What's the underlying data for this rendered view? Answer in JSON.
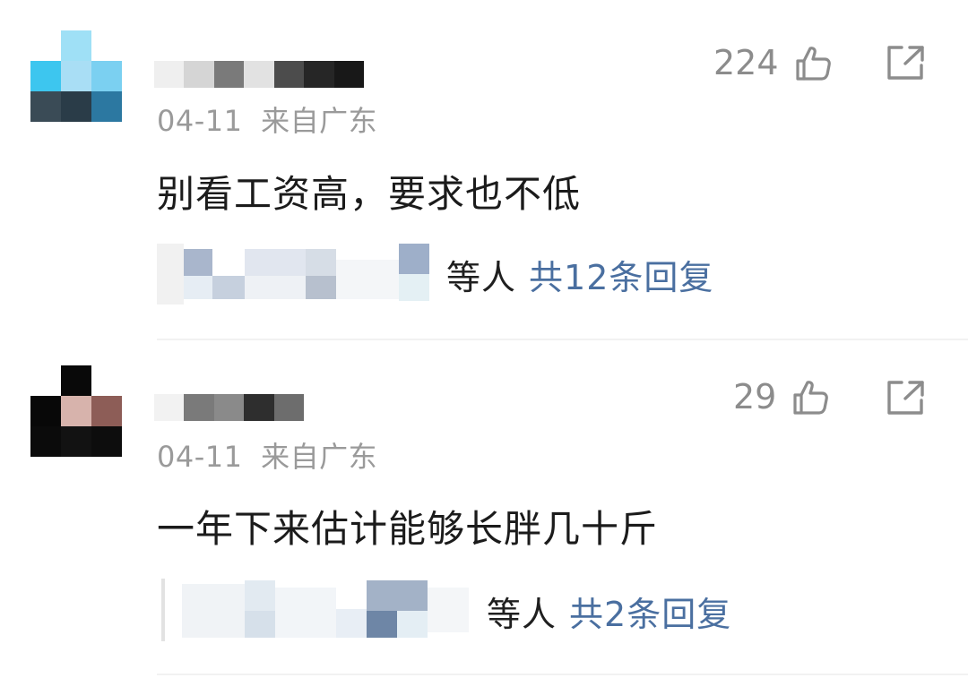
{
  "comments": [
    {
      "avatar_colors": [
        "#ffffff",
        "#9fe0f6",
        "#ffffff",
        "#3dc6ef",
        "#a9def5",
        "#7bd0f1",
        "#3a4b56",
        "#2a3c48",
        "#2c78a1"
      ],
      "name_colors": [
        "#efefef",
        "#d5d5d5",
        "#7a7a7a",
        "#e2e2e2",
        "#4c4c4c",
        "#262626",
        "#181818"
      ],
      "date": "04-11",
      "location": "来自广东",
      "text": "别看工资高，要求也不低",
      "likes": "224",
      "reply_who": "等人",
      "reply_count": "共12条回复",
      "like_icon": "thumbs-up-icon",
      "share_icon": "share-icon"
    },
    {
      "avatar_colors": [
        "#ffffff",
        "#090909",
        "#ffffff",
        "#080808",
        "#d7b3ac",
        "#8d5d57",
        "#0b0b0b",
        "#121212",
        "#0d0d0d"
      ],
      "name_colors": [
        "#f2f2f2",
        "#7a7a7a",
        "#8a8a8a",
        "#2e2e2e",
        "#6d6d6d"
      ],
      "date": "04-11",
      "location": "来自广东",
      "text": "一年下来估计能够长胖几十斤",
      "likes": "29",
      "reply_who": "等人",
      "reply_count": "共2条回复",
      "like_icon": "thumbs-up-icon",
      "share_icon": "share-icon"
    }
  ],
  "colors": {
    "text": "#1b1b1b",
    "meta": "#9a9a9a",
    "link": "#4a6fa0",
    "icon": "#8c8c8c"
  }
}
